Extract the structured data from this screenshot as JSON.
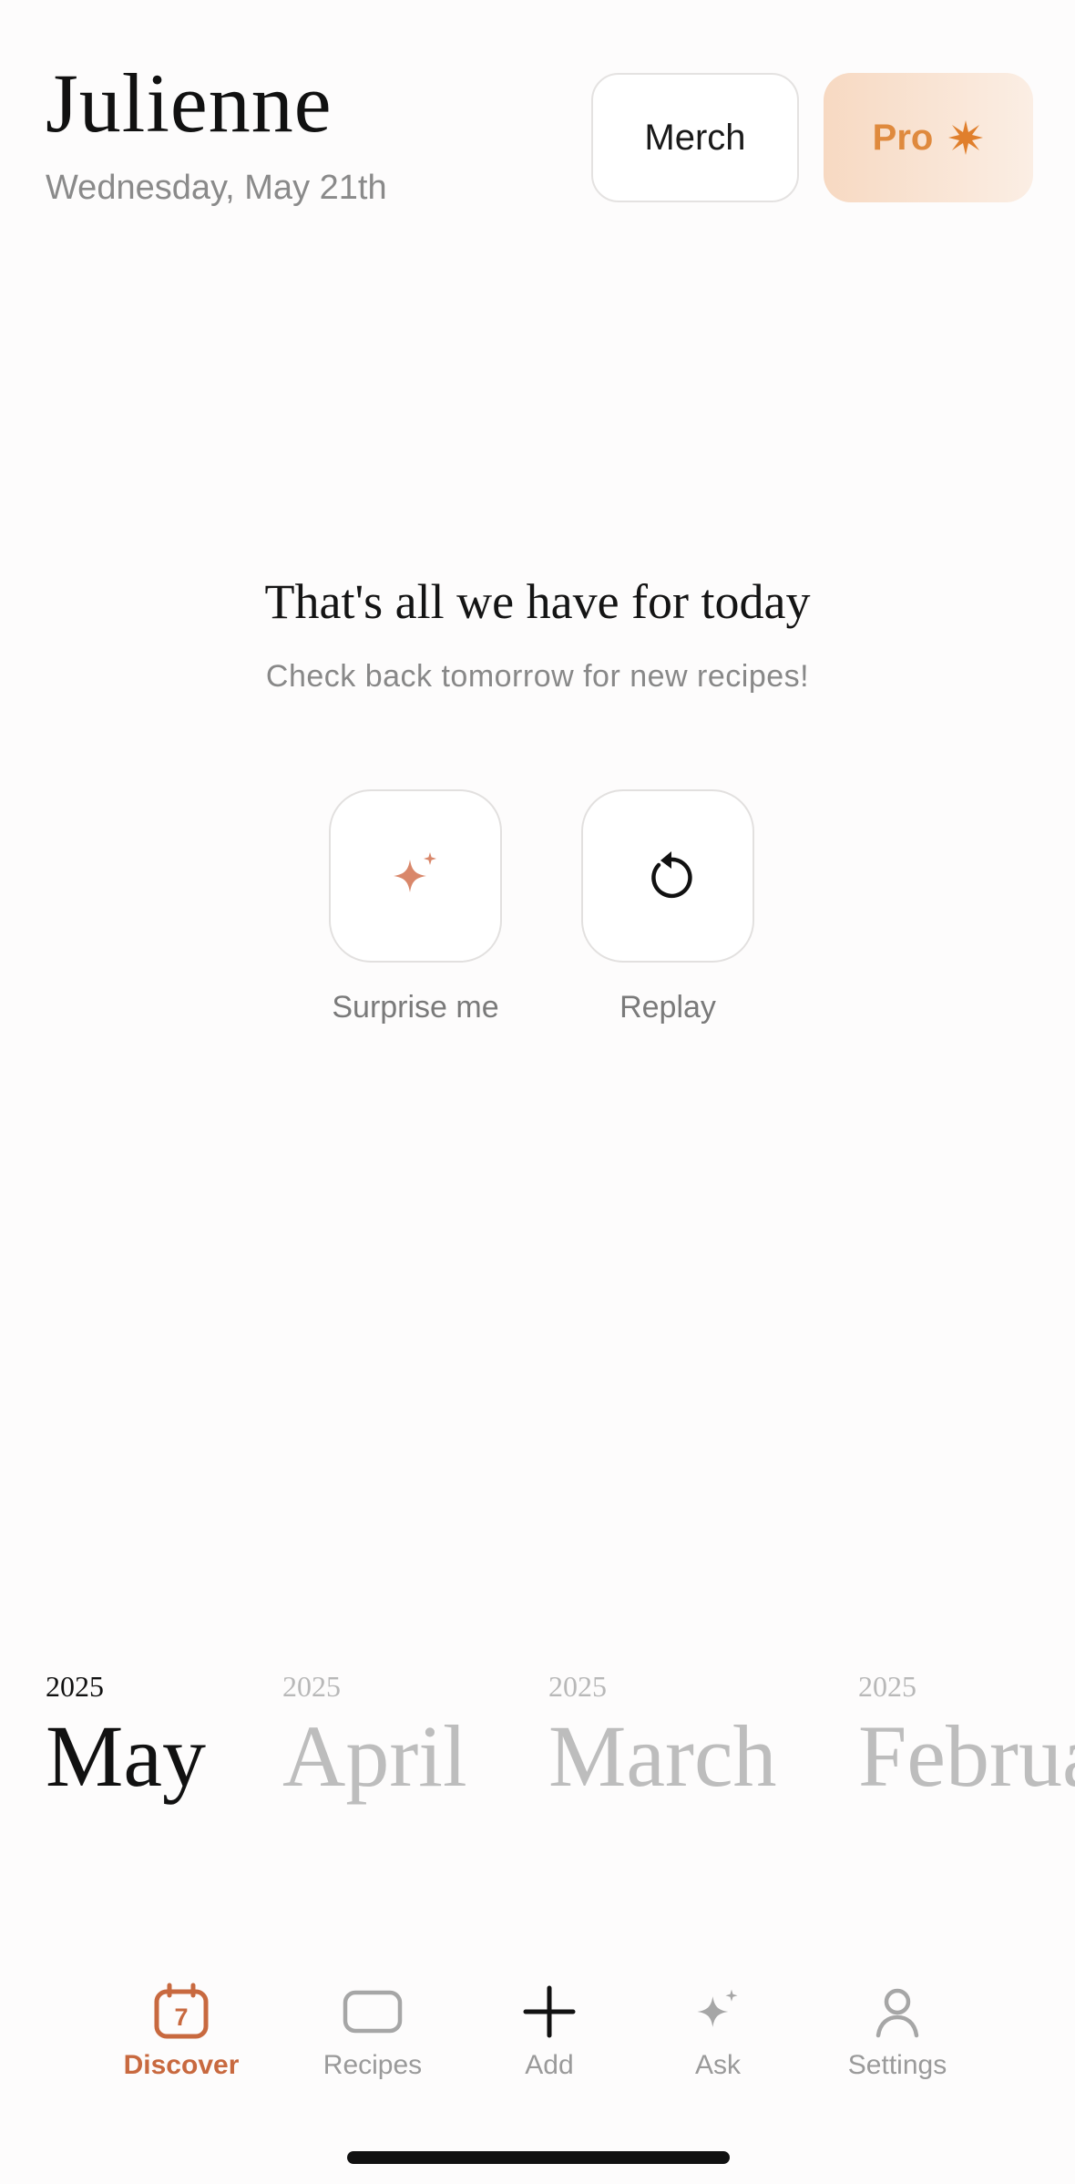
{
  "header": {
    "title": "Julienne",
    "date": "Wednesday, May 21th",
    "merch_label": "Merch",
    "pro_label": "Pro",
    "pro_icon": "sunburst-icon"
  },
  "empty_state": {
    "title": "That's all we have for today",
    "subtitle": "Check back tomorrow for new recipes!",
    "actions": [
      {
        "label": "Surprise me",
        "icon": "sparkle-icon",
        "icon_color": "#d9876a"
      },
      {
        "label": "Replay",
        "icon": "replay-icon",
        "icon_color": "#111111"
      }
    ]
  },
  "months": [
    {
      "year": "2025",
      "name": "May",
      "active": true
    },
    {
      "year": "2025",
      "name": "April",
      "active": false
    },
    {
      "year": "2025",
      "name": "March",
      "active": false
    },
    {
      "year": "2025",
      "name": "February",
      "active": false
    }
  ],
  "tabbar": {
    "tabs": [
      {
        "label": "Discover",
        "icon": "calendar-icon",
        "badge": "7",
        "active": true
      },
      {
        "label": "Recipes",
        "icon": "card-icon",
        "active": false
      },
      {
        "label": "Add",
        "icon": "plus-icon",
        "active": false
      },
      {
        "label": "Ask",
        "icon": "sparkle-icon",
        "active": false
      },
      {
        "label": "Settings",
        "icon": "person-icon",
        "active": false
      }
    ]
  },
  "colors": {
    "accent": "#c8693f",
    "pro_text": "#df8a3e",
    "muted_text": "#8a8a8a",
    "inactive_month": "#bdbdbd"
  }
}
